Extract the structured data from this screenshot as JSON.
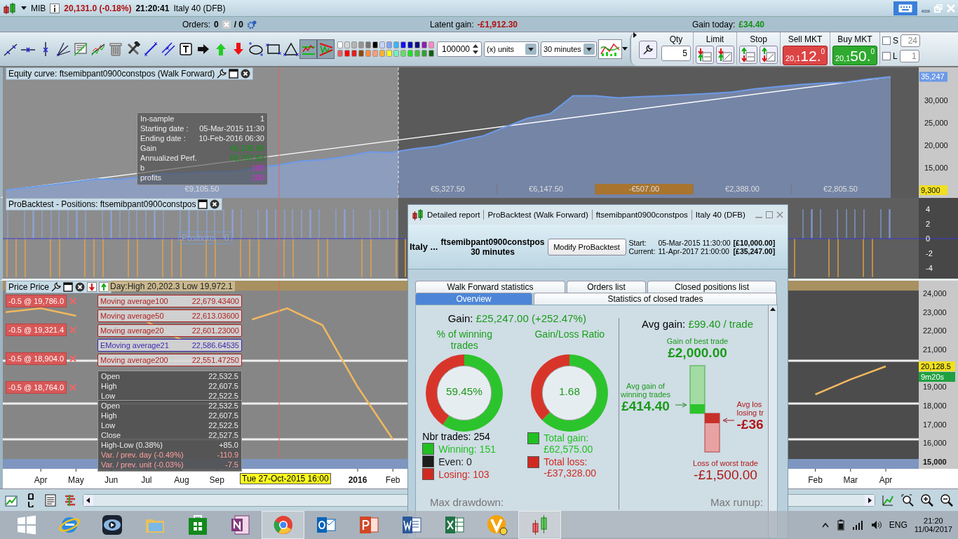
{
  "window": {
    "symbol": "MIB",
    "quote": "20,131.0 (-0.18%)",
    "time": "21:20:41",
    "instrument": "Italy 40 (DFB)"
  },
  "account_bar": {
    "orders_label": "Orders:",
    "orders": "0",
    "pending": "/ 0",
    "latent_label": "Latent gain:",
    "latent": "-£1,912.30",
    "today_label": "Gain today:",
    "today": "£34.40"
  },
  "toolbar": {
    "tools": [
      {
        "kind": "segment",
        "selected": false
      },
      {
        "kind": "horizontal",
        "selected": false
      },
      {
        "kind": "vertical",
        "selected": false
      },
      {
        "kind": "fan",
        "selected": false
      },
      {
        "kind": "listing",
        "selected": false
      },
      {
        "kind": "trendline",
        "selected": false
      },
      {
        "kind": "trash",
        "selected": false
      },
      {
        "kind": "tools",
        "selected": false
      },
      {
        "kind": "diagonal",
        "selected": false
      },
      {
        "kind": "parallel",
        "selected": false
      },
      {
        "kind": "text",
        "selected": false
      },
      {
        "kind": "arrow_right",
        "selected": false
      },
      {
        "kind": "arrow_up",
        "selected": false
      },
      {
        "kind": "arrow_down",
        "selected": false
      },
      {
        "kind": "ellipse",
        "selected": false
      },
      {
        "kind": "rectangle",
        "selected": false
      },
      {
        "kind": "triangle",
        "selected": false
      },
      {
        "kind": "channel",
        "selected": true
      },
      {
        "kind": "wedge",
        "selected": true
      }
    ],
    "palette": [
      {
        "color": "#ffffff"
      },
      {
        "color": "#d6d6d6"
      },
      {
        "color": "#b4b4b4"
      },
      {
        "color": "#949494"
      },
      {
        "color": "#767676"
      },
      {
        "color": "#000000"
      },
      {
        "color": "#c4d4ff"
      },
      {
        "color": "#80a4ff"
      },
      {
        "color": "#3cb4ff"
      },
      {
        "color": "#1010ff"
      },
      {
        "color": "#0010b0"
      },
      {
        "color": "#101080"
      },
      {
        "color": "#8a20b0"
      },
      {
        "color": "#ff88c8"
      },
      {
        "color": "#e06060"
      },
      {
        "color": "#ff0000"
      },
      {
        "color": "#e02020"
      },
      {
        "color": "#8a4a10"
      },
      {
        "color": "#ff8a40"
      },
      {
        "color": "#ff9a7a"
      },
      {
        "color": "#ffb030"
      },
      {
        "color": "#ffff00"
      },
      {
        "color": "#70f0c0"
      },
      {
        "color": "#60e060"
      },
      {
        "color": "#20e020"
      },
      {
        "color": "#40c040"
      },
      {
        "color": "#30a030"
      },
      {
        "color": "#106010"
      }
    ],
    "amount": "100000",
    "unit": "(x) units",
    "period": "30 minutes"
  },
  "order_panel": {
    "qty_label": "Qty",
    "qty": "5",
    "limit_label": "Limit",
    "stop_label": "Stop",
    "sell_label": "Sell MKT",
    "sell_prefix": "20,1",
    "sell_main": "12.",
    "sell_sup": "0",
    "buy_label": "Buy MKT",
    "buy_prefix": "20,1",
    "buy_main": "50.",
    "buy_sup": "0",
    "s_label": "S",
    "s_checked": false,
    "s_value": "24",
    "l_label": "L",
    "l_checked": false,
    "l_value": "1"
  },
  "equity_pane": {
    "title": "Equity curve: ftsemibpant0900constpos (Walk Forward)",
    "tooltip": [
      {
        "label": "In-sample",
        "value": "1",
        "kind": "plain"
      },
      {
        "label": "Starting date :",
        "value": "05-Mar-2015 11:30",
        "kind": "plain"
      },
      {
        "label": "Ending date :",
        "value": "10-Feb-2016 06:30",
        "kind": "plain"
      },
      {
        "label": "Gain",
        "value": "€9,105.50",
        "kind": "gain"
      },
      {
        "label": "Annualized Perf.",
        "value": "€9,797.53",
        "kind": "gain"
      },
      {
        "label": "b",
        "value": "100",
        "kind": "param"
      },
      {
        "label": "profits",
        "value": "100",
        "kind": "param"
      }
    ],
    "periods": [
      {
        "label": "€9,105.50",
        "kind": "in_sample"
      },
      {
        "label": "€5,327.50",
        "kind": "gain"
      },
      {
        "label": "€6,147.50",
        "kind": "gain"
      },
      {
        "label": "-€507.00",
        "kind": "loss"
      },
      {
        "label": "€2,388.00",
        "kind": "gain"
      },
      {
        "label": "€2,805.50",
        "kind": "gain"
      }
    ],
    "last_value": "35,247",
    "marker": "9,300",
    "chart_data": {
      "type": "area",
      "ylim": [
        8300,
        37300
      ],
      "yticks": [
        {
          "value": 15000,
          "label": "15,000"
        },
        {
          "value": 20000,
          "label": "20,000"
        },
        {
          "value": 25000,
          "label": "25,000"
        },
        {
          "value": 30000,
          "label": "30,000"
        }
      ],
      "series": [
        {
          "color": "#6c9ae8",
          "values": [
            10000,
            10600,
            11200,
            11800,
            12500,
            12400,
            13000,
            13700,
            13800,
            14200,
            14100,
            15000,
            15600,
            16500,
            16800,
            17500,
            18500,
            18400,
            19200,
            19800,
            21000,
            22000,
            24000,
            26000,
            27000,
            31000,
            31000,
            30500,
            30800,
            31000,
            31200,
            31500,
            31800,
            32500,
            33000,
            33500,
            33800,
            34000,
            34700,
            35200
          ]
        }
      ]
    }
  },
  "positions_pane": {
    "title": "ProBacktest - Positions: ftsemibpant0900constpos",
    "label": "Positions",
    "value": "0",
    "axis": [
      "4",
      "2",
      "0",
      "-2",
      "-4"
    ]
  },
  "price_pane": {
    "title": "Price Price",
    "day_info": "Day:High 20,202.3 Low 19,972.1",
    "orders": [
      "-0.5 @ 19,786.0",
      "-0.5 @ 19,321.4",
      "-0.5 @ 18,904.0",
      "-0.5 @ 18,764.0"
    ],
    "legends": [
      {
        "name": "Moving average100",
        "value": "22,679.43400",
        "color": "#b02020"
      },
      {
        "name": "Moving average50",
        "value": "22,613.03600",
        "color": "#b02020"
      },
      {
        "name": "Moving average20",
        "value": "22,601.23000",
        "color": "#b02020"
      },
      {
        "name": "EMoving average21",
        "value": "22,586.64535",
        "color": "#3a2ab0"
      },
      {
        "name": "Moving average200",
        "value": "22,551.47250",
        "color": "#b02020"
      }
    ],
    "ohlc_preview": [
      {
        "label": "Open",
        "value": "22,532.5"
      },
      {
        "label": "High",
        "value": "22,607.5"
      },
      {
        "label": "Low",
        "value": "22,522.5"
      }
    ],
    "ohlc": [
      {
        "label": "Open",
        "value": "22,532.5",
        "kind": "plain"
      },
      {
        "label": "High",
        "value": "22,607.5",
        "kind": "plain"
      },
      {
        "label": "Low",
        "value": "22,522.5",
        "kind": "plain"
      },
      {
        "label": "Close",
        "value": "22,527.5",
        "kind": "plain"
      },
      {
        "label": "High-Low (0.38%)",
        "value": "+85.0",
        "kind": "plain"
      },
      {
        "label": "Var. / prev. day (-0.49%)",
        "value": "-110.9",
        "kind": "loss"
      },
      {
        "label": "Var. / prev. unit (-0.03%)",
        "value": "-7.5",
        "kind": "loss"
      }
    ],
    "last_price": "20,128.5",
    "countdown": "9m20s",
    "cursor_label": "Tue 27-Oct-2015 16:00",
    "chart_data": {
      "type": "line",
      "ylim": [
        14625,
        24675
      ],
      "yticks": [
        {
          "value": 15000,
          "label": "15,000"
        },
        {
          "value": 16000,
          "label": "16,000"
        },
        {
          "value": 17000,
          "label": "17,000"
        },
        {
          "value": 18000,
          "label": "18,000"
        },
        {
          "value": 19000,
          "label": "19,000"
        },
        {
          "value": 21000,
          "label": "21,000"
        },
        {
          "value": 22000,
          "label": "22,000"
        },
        {
          "value": 23000,
          "label": "23,000"
        },
        {
          "value": 24000,
          "label": "24,000"
        }
      ],
      "categories": [
        null,
        "Apr",
        "May",
        "Jun",
        "Jul",
        "Aug",
        "Sep",
        null,
        null,
        null,
        "2016",
        "Feb",
        null,
        null,
        null,
        null,
        null,
        null,
        null,
        null,
        null,
        null,
        null,
        "Feb",
        "Mar",
        "Apr"
      ],
      "series": [
        {
          "color": "#f0b860",
          "values": [
            23000,
            23200,
            22800,
            null,
            22500,
            21500,
            null,
            22600,
            23200,
            22300,
            19000,
            16200,
            null,
            null,
            null,
            null,
            null,
            null,
            null,
            null,
            null,
            null,
            null,
            18600,
            19400,
            20100
          ]
        }
      ]
    }
  },
  "report": {
    "title_parts": [
      "Detailed report",
      "ProBacktest (Walk Forward)",
      "ftsemibpant0900constpos",
      "Italy 40 (DFB)"
    ],
    "instrument": "Italy ...",
    "strategy": "ftsemibpant0900constpos",
    "period": "30 minutes",
    "modify_button": "Modify ProBacktest",
    "start_label": "Start:",
    "start_date": "05-Mar-2015 11:30:00",
    "start_capital": "[£10,000.00]",
    "current_label": "Current:",
    "current_date": "11-Apr-2017 21:00:00",
    "current_capital": "[£35,247.00]",
    "tab_rows": [
      [
        {
          "label": "Walk Forward statistics",
          "selected": false
        },
        {
          "label": "Orders list",
          "selected": false
        },
        {
          "label": "Closed positions list",
          "selected": false
        }
      ],
      [
        {
          "label": "Overview",
          "selected": true
        },
        {
          "label": "Statistics of closed trades",
          "selected": false
        }
      ]
    ],
    "gain_label": "Gain:",
    "gain_value": "£25,247.00 (+252.47%)",
    "win_title": "% of winning trades",
    "ratio_title": "Gain/Loss Ratio",
    "win_donut": {
      "center": "59.45%",
      "chart_data": {
        "type": "donut",
        "values": [
          59.45,
          40.55
        ]
      }
    },
    "ratio_donut": {
      "center": "1.68",
      "chart_data": {
        "type": "donut",
        "values": [
          62.64,
          37.36
        ]
      }
    },
    "nbr_trades": "Nbr trades: 254",
    "breakdown": [
      {
        "label": "Winning: 151",
        "color": "#22c022"
      },
      {
        "label": "Even: 0",
        "color": "#1c1c1c"
      },
      {
        "label": "Losing: 103",
        "color": "#d02a20"
      }
    ],
    "totals": [
      {
        "label": "Total gain:",
        "value": "£62,575.00",
        "color": "#22c022"
      },
      {
        "label": "Total loss:",
        "value": "-£37,328.00",
        "color": "#d02a20"
      }
    ],
    "avg_gain_label": "Avg gain:",
    "avg_gain": "£99.40 / trade",
    "best_label": "Gain of best trade",
    "best": "£2,000.00",
    "avg_win_label": "Avg gain of winning trades",
    "avg_win": "£414.40",
    "avg_loss_label": "Avg los",
    "avg_loss_label2": "losing tr",
    "avg_loss": "-£36",
    "worst_label": "Loss of worst trade",
    "worst": "-£1,500.00",
    "drawdown_label": "Max drawdown:",
    "runup_label": "Max runup:"
  },
  "taskbar": {
    "apps": [
      {
        "kind": "ie",
        "selected": false
      },
      {
        "kind": "media",
        "selected": false
      },
      {
        "kind": "folder",
        "selected": false
      },
      {
        "kind": "store",
        "selected": false
      },
      {
        "kind": "onenote",
        "selected": false
      },
      {
        "kind": "chrome",
        "selected": true
      },
      {
        "kind": "outlook",
        "selected": false
      },
      {
        "kind": "powerpoint",
        "selected": false
      },
      {
        "kind": "word",
        "selected": false
      },
      {
        "kind": "excel",
        "selected": false
      },
      {
        "kind": "v6",
        "selected": false
      },
      {
        "kind": "candles",
        "selected": true
      }
    ],
    "language": "ENG",
    "time": "21:20",
    "date": "11/04/2017"
  }
}
